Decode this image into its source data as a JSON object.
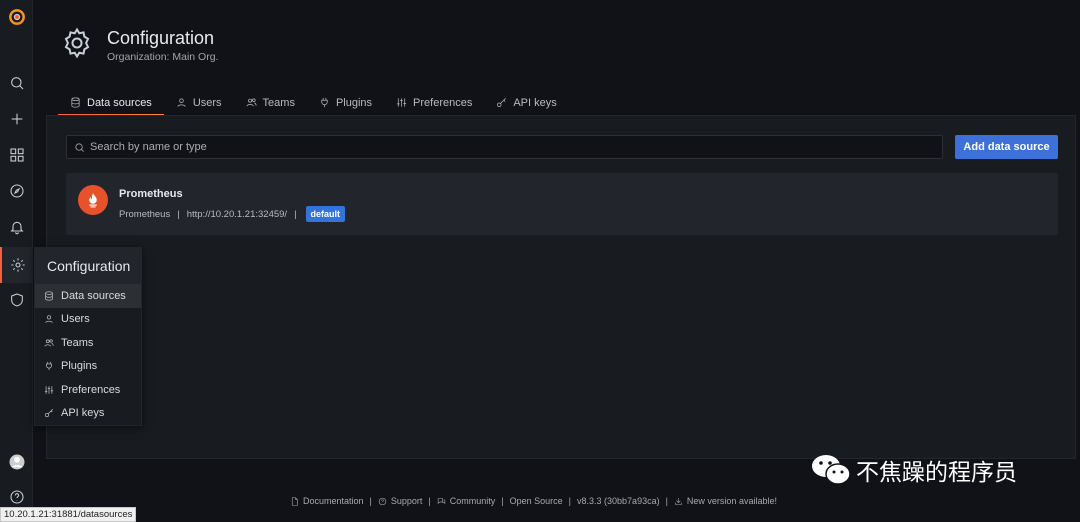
{
  "page": {
    "title": "Configuration",
    "subtitle": "Organization: Main Org."
  },
  "tabs": [
    {
      "label": "Data sources",
      "icon": "database-icon",
      "active": true
    },
    {
      "label": "Users",
      "icon": "user-icon"
    },
    {
      "label": "Teams",
      "icon": "users-icon"
    },
    {
      "label": "Plugins",
      "icon": "plug-icon"
    },
    {
      "label": "Preferences",
      "icon": "sliders-icon"
    },
    {
      "label": "API keys",
      "icon": "key-icon"
    }
  ],
  "search": {
    "placeholder": "Search by name or type"
  },
  "add_button": "Add data source",
  "datasource": {
    "name": "Prometheus",
    "type": "Prometheus",
    "url": "http://10.20.1.21:32459/",
    "badge": "default"
  },
  "flyout": {
    "title": "Configuration",
    "items": [
      {
        "label": "Data sources",
        "icon": "database-icon",
        "active": true
      },
      {
        "label": "Users",
        "icon": "user-icon"
      },
      {
        "label": "Teams",
        "icon": "users-icon"
      },
      {
        "label": "Plugins",
        "icon": "plug-icon"
      },
      {
        "label": "Preferences",
        "icon": "sliders-icon"
      },
      {
        "label": "API keys",
        "icon": "key-icon"
      }
    ]
  },
  "footer": {
    "documentation": "Documentation",
    "support": "Support",
    "community": "Community",
    "open_source": "Open Source",
    "version": "v8.3.3 (30bb7a93ca)",
    "new_version": "New version available!"
  },
  "watermark": "不焦躁的程序员",
  "status_url": "10.20.1.21:31881/datasources",
  "colors": {
    "accent": "#3d71d9",
    "brand": "#f55f3e",
    "prometheus": "#e6522c"
  }
}
